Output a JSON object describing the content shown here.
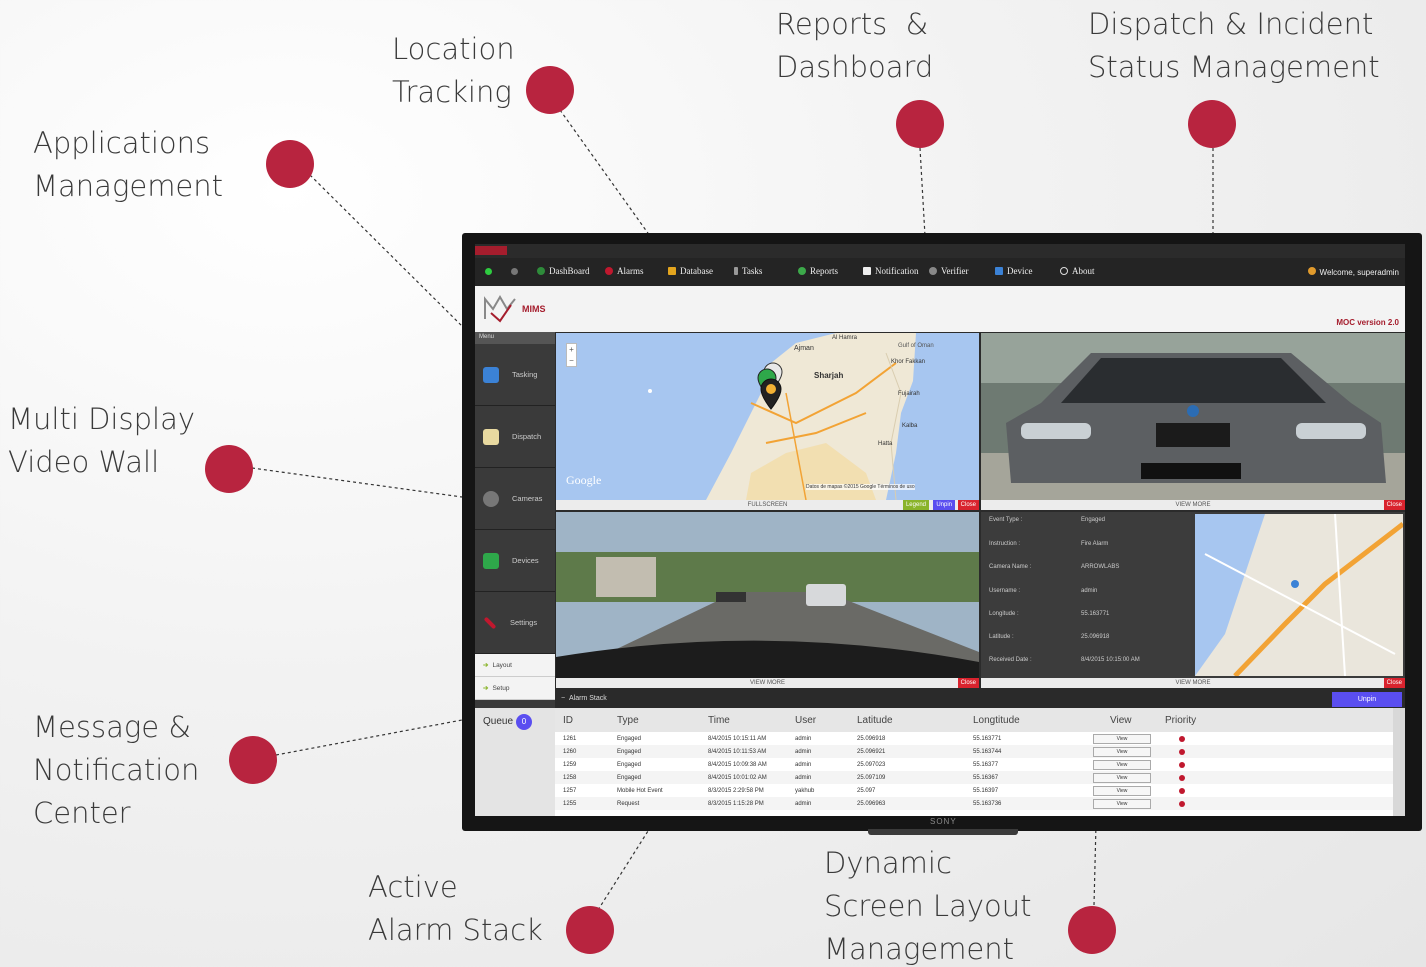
{
  "callouts": {
    "location_tracking": "Location\nTracking",
    "reports_dashboard": "Reports  &\nDashboard",
    "dispatch_incident": "Dispatch & Incident\nStatus Management",
    "applications_management": "Applications\nManagement",
    "multi_display": "Multi Display\nVideo Wall",
    "message_notification": "Message &\nNotification\nCenter",
    "active_alarm": "Active\nAlarm Stack",
    "dynamic_layout": "Dynamic\nScreen Layout\nManagement"
  },
  "colors": {
    "accent": "#b8243f",
    "brand": "#a51d2d",
    "unpin": "#5a4ef0"
  },
  "nav": [
    {
      "label": "DashBoard",
      "icon": "dashboard-icon"
    },
    {
      "label": "Alarms",
      "icon": "alarm-icon"
    },
    {
      "label": "Database",
      "icon": "database-icon"
    },
    {
      "label": "Tasks",
      "icon": "tasks-icon"
    },
    {
      "label": "Reports",
      "icon": "reports-icon"
    },
    {
      "label": "Notification",
      "icon": "notification-icon"
    },
    {
      "label": "Verifier",
      "icon": "verifier-icon"
    },
    {
      "label": "Device",
      "icon": "device-icon"
    },
    {
      "label": "About",
      "icon": "about-icon"
    }
  ],
  "welcome": "Welcome, superadmin",
  "brand": {
    "name": "MIMS",
    "version": "MOC version 2.0"
  },
  "sidebar": {
    "menu_label": "Menu",
    "items": [
      "Tasking",
      "Dispatch",
      "Cameras",
      "Devices",
      "Settings"
    ],
    "subitems": [
      "Layout",
      "Setup"
    ]
  },
  "panels": {
    "map": {
      "bar": "FULLSCREEN",
      "legend": "Legend",
      "unpin": "Unpin",
      "close": "Close",
      "labels": [
        "Ajman",
        "Sharjah",
        "Khor Fakkan",
        "Fujairah",
        "Kalba",
        "Hatta",
        "Al Hamra",
        "Gulf of Oman"
      ],
      "attribution": "Datos de mapas ©2015 Google   Términos de uso",
      "google": "Google"
    },
    "camera1": {
      "bar": "VIEW MORE",
      "close": "Close"
    },
    "camera2": {
      "bar": "VIEW MORE",
      "close": "Close"
    },
    "info": {
      "bar": "VIEW MORE",
      "close": "Close",
      "fields": [
        {
          "label": "Event Type :",
          "value": "Engaged"
        },
        {
          "label": "Instruction :",
          "value": "Fire Alarm"
        },
        {
          "label": "Camera Name :",
          "value": "ARROWLABS"
        },
        {
          "label": "Username :",
          "value": "admin"
        },
        {
          "label": "Longitude :",
          "value": "55.163771"
        },
        {
          "label": "Latitude :",
          "value": "25.096918"
        },
        {
          "label": "Received Date :",
          "value": "8/4/2015 10:15:00 AM"
        }
      ]
    }
  },
  "alarm_stack": {
    "title": "Alarm Stack",
    "unpin": "Unpin",
    "queue_label": "Queue",
    "queue_count": "0",
    "columns": [
      "ID",
      "Type",
      "Time",
      "User",
      "Latitude",
      "Longtitude",
      "View",
      "Priority"
    ],
    "rows": [
      [
        "1261",
        "Engaged",
        "8/4/2015 10:15:11 AM",
        "admin",
        "25.096918",
        "55.163771",
        "View"
      ],
      [
        "1260",
        "Engaged",
        "8/4/2015 10:11:53 AM",
        "admin",
        "25.096921",
        "55.163744",
        "View"
      ],
      [
        "1259",
        "Engaged",
        "8/4/2015 10:09:38 AM",
        "admin",
        "25.097023",
        "55.16377",
        "View"
      ],
      [
        "1258",
        "Engaged",
        "8/4/2015 10:01:02 AM",
        "admin",
        "25.097109",
        "55.16367",
        "View"
      ],
      [
        "1257",
        "Mobile Hot Event",
        "8/3/2015 2:29:58 PM",
        "yakhub",
        "25.097",
        "55.16397",
        "View"
      ],
      [
        "1255",
        "Request",
        "8/3/2015 1:15:28 PM",
        "admin",
        "25.096963",
        "55.163736",
        "View"
      ]
    ]
  },
  "tv_brand": "SONY"
}
